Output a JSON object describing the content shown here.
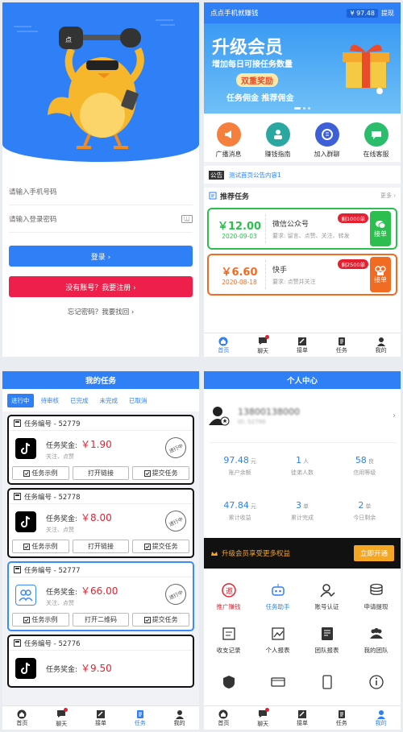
{
  "login": {
    "phone_placeholder": "请输入手机号码",
    "password_placeholder": "请输入登录密码",
    "login_button": "登录 ›",
    "register_button": "没有账号？我要注册 ›",
    "forgot_link": "忘记密码？我要找回 ›"
  },
  "home": {
    "header_title": "点点手机就赚钱",
    "balance": "¥ 97.48",
    "withdraw": "提现",
    "banner": {
      "title": "升级会员",
      "subtitle": "增加每日可接任务数量",
      "highlight": "双重奖励",
      "bottom": "任务佣金  推荐佣金"
    },
    "features": [
      {
        "label": "广播消息",
        "color": "#f5803e",
        "icon": "broadcast-icon"
      },
      {
        "label": "赚钱指南",
        "color": "#2aa7a0",
        "icon": "guide-icon"
      },
      {
        "label": "加入群聊",
        "color": "#3d5fd8",
        "icon": "group-chat-icon"
      },
      {
        "label": "在线客服",
        "color": "#2bbd6b",
        "icon": "service-icon"
      }
    ],
    "notice_label": "公告",
    "notice_text": "测试首页公告内容1",
    "recommend_title": "推荐任务",
    "more": "更多 ›",
    "tasks": [
      {
        "price": "￥12.00",
        "date": "2020-09-03",
        "title": "微信公众号",
        "tag": "剩1000单",
        "req": "要求: 留言、点赞、关注、转发",
        "action": "接单",
        "color": "#2cbf4f"
      },
      {
        "price": "￥6.60",
        "date": "2020-08-18",
        "title": "快手",
        "tag": "剩2500单",
        "req": "要求: 点赞并关注",
        "action": "接单",
        "color": "#f26b22"
      }
    ]
  },
  "tabbar": [
    {
      "label": "首页",
      "icon": "home-icon"
    },
    {
      "label": "聊天",
      "icon": "chat-icon"
    },
    {
      "label": "接单",
      "icon": "accept-icon"
    },
    {
      "label": "任务",
      "icon": "task-icon"
    },
    {
      "label": "我的",
      "icon": "profile-icon"
    }
  ],
  "mytasks": {
    "title": "我的任务",
    "tabs": [
      "进行中",
      "待审核",
      "已完成",
      "未完成",
      "已取消"
    ],
    "items": [
      {
        "no": "任务编号 - 52779",
        "reward_label": "任务奖金:",
        "reward": "￥1.90",
        "sub": "关注、点赞",
        "stamp": "进行中",
        "btns": [
          "任务示例",
          "打开链接",
          "提交任务"
        ],
        "logo": "tiktok",
        "border": "#111111"
      },
      {
        "no": "任务编号 - 52778",
        "reward_label": "任务奖金:",
        "reward": "￥8.00",
        "sub": "关注、点赞",
        "stamp": "进行中",
        "btns": [
          "任务示例",
          "打开链接",
          "提交任务"
        ],
        "logo": "tiktok",
        "border": "#111111"
      },
      {
        "no": "任务编号 - 52777",
        "reward_label": "任务奖金:",
        "reward": "￥66.00",
        "sub": "关注、点赞",
        "stamp": "进行中",
        "btns": [
          "任务示例",
          "打开二维码",
          "提交任务"
        ],
        "logo": "qq",
        "border": "#3b8cf5"
      },
      {
        "no": "任务编号 - 52776",
        "reward_label": "任务奖金:",
        "reward": "￥9.50",
        "sub": "",
        "stamp": "",
        "btns": [],
        "logo": "tiktok",
        "border": "#111111"
      }
    ]
  },
  "personal": {
    "title": "个人中心",
    "phone": "13800138000",
    "uid": "ID: 52799",
    "stats": [
      {
        "value": "97.48",
        "unit": "元",
        "label": "账户余额"
      },
      {
        "value": "1",
        "unit": "人",
        "label": "徒弟人数"
      },
      {
        "value": "58",
        "unit": "良",
        "label": "信用等级"
      },
      {
        "value": "47.84",
        "unit": "元",
        "label": "累计收益"
      },
      {
        "value": "3",
        "unit": "单",
        "label": "累计完成"
      },
      {
        "value": "2",
        "unit": "单",
        "label": "今日剩余"
      }
    ],
    "vip_text": "升级会员享受更多权益",
    "vip_button": "立即开通",
    "grid": [
      {
        "label": "推广赚钱",
        "icon": "promote-icon"
      },
      {
        "label": "任务助手",
        "icon": "robot-icon"
      },
      {
        "label": "账号认证",
        "icon": "verify-icon"
      },
      {
        "label": "申请提现",
        "icon": "coins-icon"
      },
      {
        "label": "收支记录",
        "icon": "record-icon"
      },
      {
        "label": "个人报表",
        "icon": "chart-icon"
      },
      {
        "label": "团队报表",
        "icon": "team-report-icon"
      },
      {
        "label": "我的团队",
        "icon": "team-icon"
      },
      {
        "label": "",
        "icon": "badge-icon"
      },
      {
        "label": "",
        "icon": "card-icon"
      },
      {
        "label": "",
        "icon": "phone-icon"
      },
      {
        "label": "",
        "icon": "info-icon"
      }
    ]
  }
}
